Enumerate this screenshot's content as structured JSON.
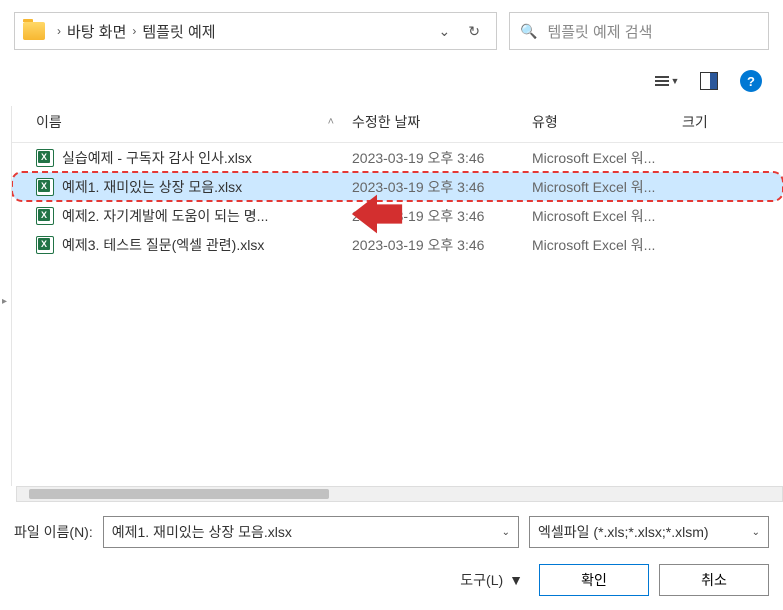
{
  "breadcrumb": {
    "items": [
      "바탕 화면",
      "템플릿 예제"
    ]
  },
  "search": {
    "placeholder": "템플릿 예제 검색"
  },
  "headers": {
    "name": "이름",
    "date": "수정한 날짜",
    "type": "유형",
    "size": "크기"
  },
  "files": [
    {
      "name": "실습예제 - 구독자 감사 인사.xlsx",
      "date": "2023-03-19 오후 3:46",
      "type": "Microsoft Excel 워...",
      "selected": false,
      "highlighted": false
    },
    {
      "name": "예제1. 재미있는 상장 모음.xlsx",
      "date": "2023-03-19 오후 3:46",
      "type": "Microsoft Excel 워...",
      "selected": true,
      "highlighted": true
    },
    {
      "name": "예제2. 자기계발에 도움이 되는 명...",
      "date": "2023-03-19 오후 3:46",
      "type": "Microsoft Excel 워...",
      "selected": false,
      "highlighted": false
    },
    {
      "name": "예제3. 테스트 질문(엑셀 관련).xlsx",
      "date": "2023-03-19 오후 3:46",
      "type": "Microsoft Excel 워...",
      "selected": false,
      "highlighted": false
    }
  ],
  "filename": {
    "label": "파일 이름(N):",
    "value": "예제1. 재미있는 상장 모음.xlsx"
  },
  "filetype": {
    "value": "엑셀파일 (*.xls;*.xlsx;*.xlsm)"
  },
  "buttons": {
    "tools": "도구(L)",
    "ok": "확인",
    "cancel": "취소"
  }
}
